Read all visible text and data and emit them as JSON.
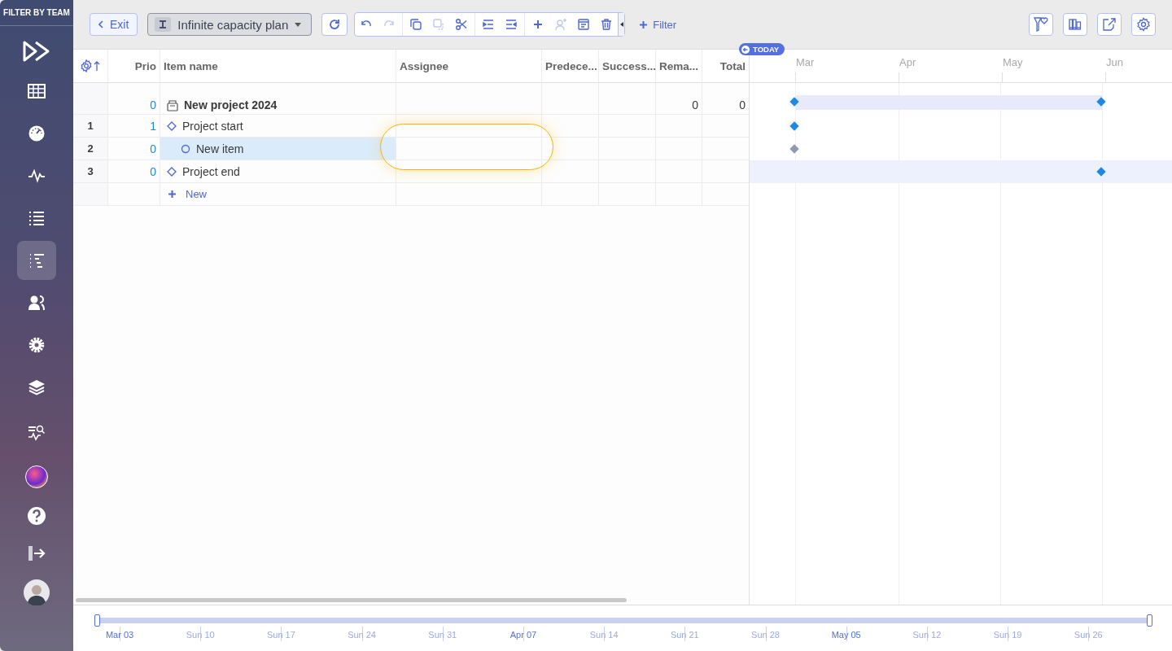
{
  "sidebar": {
    "header": "FILTER BY TEAM",
    "items": [
      {
        "selected": false
      },
      {
        "selected": false
      },
      {
        "selected": false
      },
      {
        "selected": false
      },
      {
        "selected": true
      },
      {
        "selected": false
      },
      {
        "selected": false
      },
      {
        "selected": false
      },
      {
        "selected": false
      }
    ]
  },
  "toolbar": {
    "exit": "Exit",
    "plan": "Infinite capacity plan",
    "actions": [
      {
        "disabled": false
      },
      {
        "disabled": true
      },
      {
        "disabled": false
      },
      {
        "disabled": true
      },
      {
        "disabled": false
      },
      {
        "disabled": false
      },
      {
        "disabled": false
      },
      {
        "disabled": false
      },
      {
        "disabled": true
      },
      {
        "disabled": false
      },
      {
        "disabled": false
      }
    ],
    "filter": "Filter"
  },
  "table": {
    "columns": [
      {
        "label": "Prio"
      },
      {
        "label": "Item name"
      },
      {
        "label": "Assignee"
      },
      {
        "label": "Predece..."
      },
      {
        "label": "Success..."
      },
      {
        "label": "Rema..."
      },
      {
        "label": "Total"
      }
    ],
    "rows": [
      {
        "kind": "project",
        "number": "",
        "prio": "0",
        "name": "New project 2024",
        "remaining": "0",
        "total": "0",
        "selected": false,
        "hovered": false
      },
      {
        "kind": "milestone",
        "number": "1",
        "prio": "1",
        "name": "Project start",
        "remaining": "",
        "total": "",
        "selected": false,
        "hovered": false
      },
      {
        "kind": "task",
        "number": "2",
        "prio": "0",
        "name": "New item",
        "remaining": "",
        "total": "",
        "selected": true,
        "hovered": false
      },
      {
        "kind": "milestone",
        "number": "3",
        "prio": "0",
        "name": "Project end",
        "remaining": "",
        "total": "",
        "selected": false,
        "hovered": true
      }
    ],
    "new_row": "New"
  },
  "gantt": {
    "today": "TODAY",
    "months": [
      "Mar",
      "Apr",
      "May",
      "Jun"
    ]
  },
  "timeline": {
    "level": 1,
    "ticks": [
      {
        "label": "Mar 03",
        "month_start": true
      },
      {
        "label": "Sun 10",
        "month_start": false
      },
      {
        "label": "Sun 17",
        "month_start": false
      },
      {
        "label": "Sun 24",
        "month_start": false
      },
      {
        "label": "Sun 31",
        "month_start": false
      },
      {
        "label": "Apr 07",
        "month_start": true
      },
      {
        "label": "Sun 14",
        "month_start": false
      },
      {
        "label": "Sun 21",
        "month_start": false
      },
      {
        "label": "Sun 28",
        "month_start": false
      },
      {
        "label": "May 05",
        "month_start": true
      },
      {
        "label": "Sun 12",
        "month_start": false
      },
      {
        "label": "Sun 19",
        "month_start": false
      },
      {
        "label": "Sun 26",
        "month_start": false
      }
    ]
  }
}
